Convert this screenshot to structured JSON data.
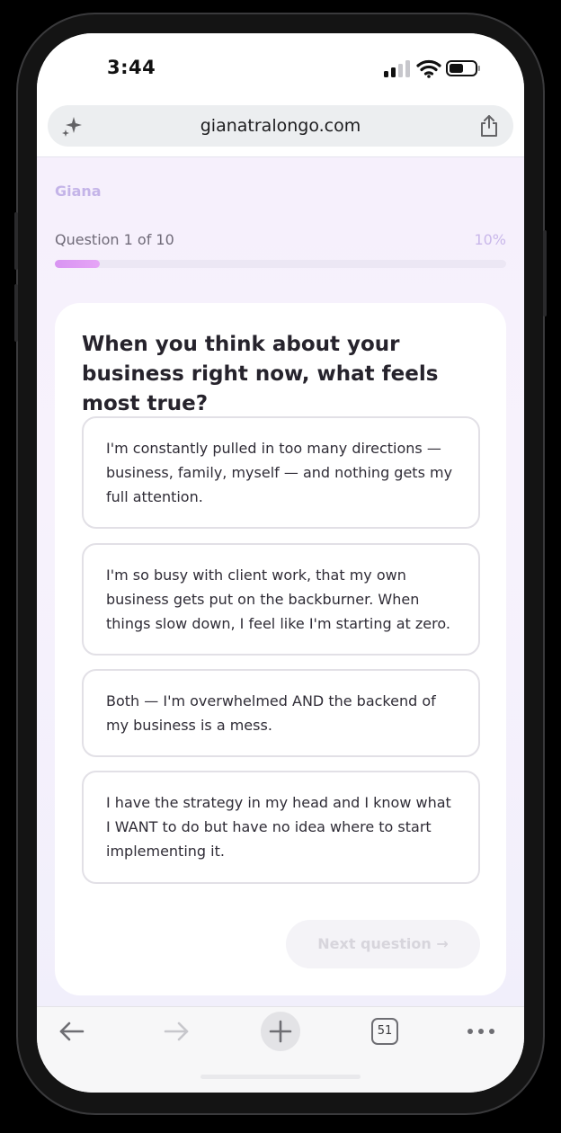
{
  "status_bar": {
    "time": "3:44"
  },
  "browser": {
    "url": "gianatralongo.com",
    "tab_count": "51"
  },
  "page": {
    "brand": "Giana",
    "progress": {
      "label": "Question 1 of 10",
      "percent_text": "10%",
      "fraction": 0.1
    },
    "question": "When you think about your business right now, what feels most true?",
    "options": [
      {
        "text": "I'm constantly pulled in too many directions — business, family, myself — and nothing gets my full attention."
      },
      {
        "text": "I'm so busy with client work, that my own business gets put on the backburner. When things slow down, I feel like I'm starting at zero."
      },
      {
        "text": "Both — I'm overwhelmed AND the backend of my business is a mess."
      },
      {
        "text": "I have the strategy in my head and I know what I WANT to do but have no idea where to start implementing it."
      }
    ],
    "next_button": "Next question →"
  },
  "colors": {
    "accent": "#d894f2",
    "brand_text": "#c4b4e8",
    "page_background": "#f6f0fc"
  }
}
